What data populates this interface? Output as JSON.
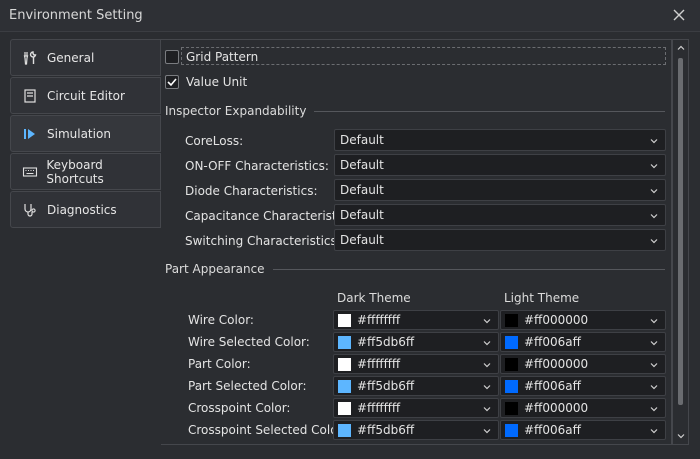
{
  "window": {
    "title": "Environment Setting"
  },
  "sidebar": {
    "items": [
      {
        "label": "General",
        "icon": "wrench-screwdriver-icon"
      },
      {
        "label": "Circuit Editor",
        "icon": "circuit-editor-icon"
      },
      {
        "label": "Simulation",
        "icon": "play-icon"
      },
      {
        "label": "Keyboard Shortcuts",
        "icon": "keyboard-icon"
      },
      {
        "label": "Diagnostics",
        "icon": "stethoscope-icon"
      }
    ]
  },
  "options": {
    "grid_pattern": {
      "label": "Grid Pattern",
      "checked": false
    },
    "value_unit": {
      "label": "Value Unit",
      "checked": true
    }
  },
  "inspector": {
    "title": "Inspector Expandability",
    "fields": [
      {
        "label": "CoreLoss:",
        "value": "Default"
      },
      {
        "label": "ON-OFF Characteristics:",
        "value": "Default"
      },
      {
        "label": "Diode Characteristics:",
        "value": "Default"
      },
      {
        "label": "Capacitance Characteristics:",
        "value": "Default"
      },
      {
        "label": "Switching Characteristics:",
        "value": "Default"
      }
    ]
  },
  "appearance": {
    "title": "Part Appearance",
    "dark_header": "Dark Theme",
    "light_header": "Light Theme",
    "rows": [
      {
        "label": "Wire Color:",
        "dark": "#ffffffff",
        "dark_swatch": "#ffffff",
        "light": "#ff000000",
        "light_swatch": "#000000"
      },
      {
        "label": "Wire Selected Color:",
        "dark": "#ff5db6ff",
        "dark_swatch": "#5db6ff",
        "light": "#ff006aff",
        "light_swatch": "#006aff"
      },
      {
        "label": "Part Color:",
        "dark": "#ffffffff",
        "dark_swatch": "#ffffff",
        "light": "#ff000000",
        "light_swatch": "#000000"
      },
      {
        "label": "Part Selected Color:",
        "dark": "#ff5db6ff",
        "dark_swatch": "#5db6ff",
        "light": "#ff006aff",
        "light_swatch": "#006aff"
      },
      {
        "label": "Crosspoint Color:",
        "dark": "#ffffffff",
        "dark_swatch": "#ffffff",
        "light": "#ff000000",
        "light_swatch": "#000000"
      },
      {
        "label": "Crosspoint Selected Color:",
        "dark": "#ff5db6ff",
        "dark_swatch": "#5db6ff",
        "light": "#ff006aff",
        "light_swatch": "#006aff"
      }
    ]
  },
  "colors": {
    "accent": "#5db6ff",
    "background": "#2b2d31"
  }
}
